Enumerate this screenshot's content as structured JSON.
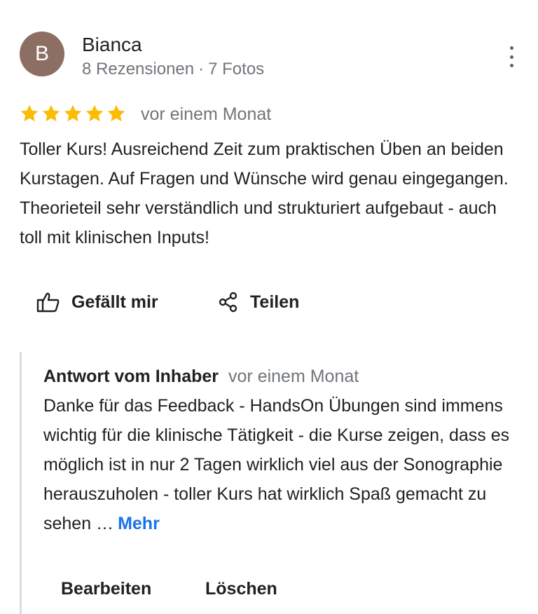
{
  "reviewer": {
    "avatar_letter": "B",
    "name": "Bianca",
    "review_count": "8 Rezensionen",
    "separator": "·",
    "photo_count": "7 Fotos"
  },
  "rating": {
    "stars": 5,
    "max": 5,
    "color": "#fbbc04"
  },
  "review": {
    "date": "vor einem Monat",
    "text": "Toller Kurs! Ausreichend Zeit zum praktischen Üben an beiden Kurstagen. Auf Fragen und Wünsche wird genau eingegangen. Theorieteil sehr verständlich und strukturiert aufgebaut - auch toll mit klinischen Inputs!"
  },
  "actions": {
    "like_label": "Gefällt mir",
    "share_label": "Teilen"
  },
  "owner_reply": {
    "label": "Antwort vom Inhaber",
    "date": "vor einem Monat",
    "text": "Danke für das Feedback - HandsOn Übungen sind immens wichtig für die klinische Tätigkeit - die Kurse zeigen, dass es möglich ist in nur 2 Tagen wirklich viel aus der Sonographie herauszuholen - toller Kurs hat wirklich Spaß gemacht zu sehen …",
    "more_label": "Mehr",
    "edit_label": "Bearbeiten",
    "delete_label": "Löschen"
  },
  "icons": {
    "more": "more-vert-icon",
    "like": "thumb-up-icon",
    "share": "share-icon",
    "star": "star-icon"
  },
  "colors": {
    "avatar_bg": "#8d6e63",
    "link": "#1a73e8",
    "secondary_text": "#70757a"
  }
}
